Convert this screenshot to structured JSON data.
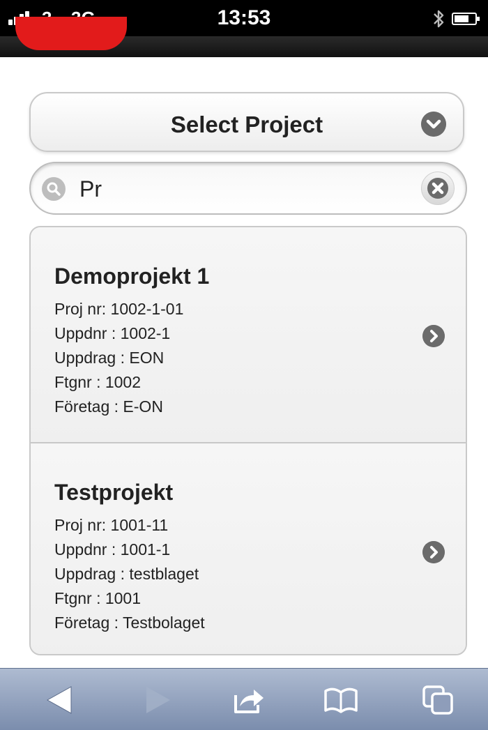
{
  "status_bar": {
    "carrier": "3",
    "network": "3G",
    "time": "13:53"
  },
  "select": {
    "label": "Select Project",
    "icon": "chevron-down-icon"
  },
  "search": {
    "value": "Pr",
    "icon": "search-icon",
    "clear_icon": "clear-icon"
  },
  "projects": [
    {
      "title": "Demoprojekt 1",
      "lines": [
        "Proj nr: 1002-1-01",
        "Uppdnr : 1002-1",
        "Uppdrag : EON",
        "Ftgnr : 1002",
        "Företag : E-ON"
      ]
    },
    {
      "title": "Testprojekt",
      "lines": [
        "Proj nr: 1001-11",
        "Uppdnr : 1001-1",
        "Uppdrag : testblaget",
        "Ftgnr : 1001",
        "Företag : Testbolaget"
      ]
    }
  ],
  "toolbar": {
    "icons": [
      "back-icon",
      "forward-icon",
      "share-icon",
      "bookmarks-icon",
      "tabs-icon"
    ]
  },
  "colors": {
    "accent_red": "#e21b1b",
    "toolbar_blue": "#8e9dba",
    "icon_grey": "#6b6b6b"
  }
}
